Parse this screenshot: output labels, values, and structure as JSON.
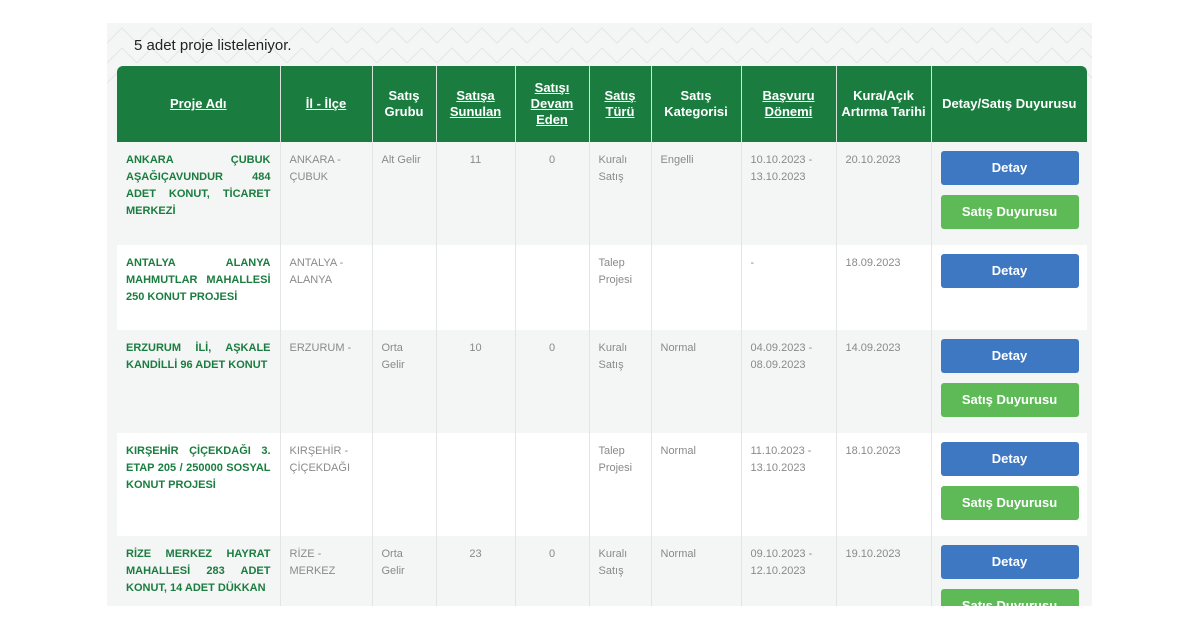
{
  "listing_count": "5 adet proje listeleniyor.",
  "headers": {
    "proje_adi": "Proje Adı",
    "il_ilce": "İl - İlçe",
    "satis_grubu": "Satış Grubu",
    "satisa_sunulan": "Satışa Sunulan",
    "satisi_devam_eden": "Satışı Devam Eden",
    "satis_turu": "Satış Türü",
    "satis_kategorisi": "Satış Kategorisi",
    "basvuru_donemi": "Başvuru Dönemi",
    "kura_tarihi": "Kura/Açık Artırma Tarihi",
    "detay_duyuru": "Detay/Satış Duyurusu"
  },
  "buttons": {
    "detay": "Detay",
    "satis_duyurusu": "Satış Duyurusu"
  },
  "rows": [
    {
      "name": "ANKARA ÇUBUK AŞAĞIÇAVUNDUR 484 ADET KONUT, TİCARET MERKEZİ",
      "location": "ANKARA - ÇUBUK",
      "group": "Alt Gelir",
      "offered": "11",
      "ongoing": "0",
      "type": "Kuralı Satış",
      "category": "Engelli",
      "period": "10.10.2023 - 13.10.2023",
      "draw_date": "20.10.2023"
    },
    {
      "name": "ANTALYA ALANYA MAHMUTLAR MAHALLESİ 250 KONUT PROJESİ",
      "location": "ANTALYA - ALANYA",
      "group": "",
      "offered": "",
      "ongoing": "",
      "type": "Talep Projesi",
      "category": "",
      "period": "-",
      "draw_date": "18.09.2023"
    },
    {
      "name": "ERZURUM İLİ, AŞKALE KANDİLLİ 96 ADET KONUT",
      "location": "ERZURUM -",
      "group": "Orta Gelir",
      "offered": "10",
      "ongoing": "0",
      "type": "Kuralı Satış",
      "category": "Normal",
      "period": "04.09.2023 - 08.09.2023",
      "draw_date": "14.09.2023"
    },
    {
      "name": "KIRŞEHİR ÇİÇEKDAĞI 3. ETAP 205 / 250000 SOSYAL KONUT PROJESİ",
      "location": "KIRŞEHİR - ÇİÇEKDAĞI",
      "group": "",
      "offered": "",
      "ongoing": "",
      "type": "Talep Projesi",
      "category": "Normal",
      "period": "11.10.2023 - 13.10.2023",
      "draw_date": "18.10.2023"
    },
    {
      "name": "RİZE MERKEZ HAYRAT MAHALLESİ 283 ADET KONUT, 14 ADET DÜKKAN",
      "location": "RİZE - MERKEZ",
      "group": "Orta Gelir",
      "offered": "23",
      "ongoing": "0",
      "type": "Kuralı Satış",
      "category": "Normal",
      "period": "09.10.2023 - 12.10.2023",
      "draw_date": "19.10.2023"
    }
  ],
  "colors": {
    "header_green": "#1a7d3f",
    "detay_blue": "#3e78c2",
    "duyuru_green": "#5dba57"
  }
}
